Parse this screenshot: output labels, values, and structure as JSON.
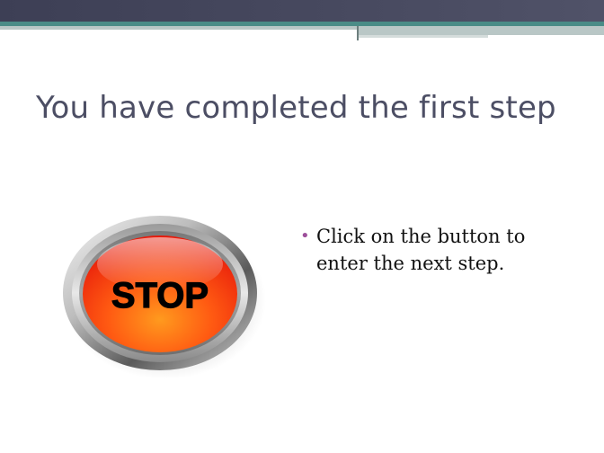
{
  "slide": {
    "title": "You have completed the first step",
    "bullets": [
      {
        "marker": "•",
        "text": "Click on the button to enter the next step."
      }
    ],
    "button": {
      "label": "STOP",
      "icon": "stop-button-icon"
    }
  },
  "colors": {
    "banner_dark": "#3d3f55",
    "banner_teal": "#4a8c87",
    "title_text": "#4c4e64",
    "bullet_marker": "#9d4f9b",
    "button_red": "#f0260e",
    "button_orange": "#ff7a1a"
  }
}
